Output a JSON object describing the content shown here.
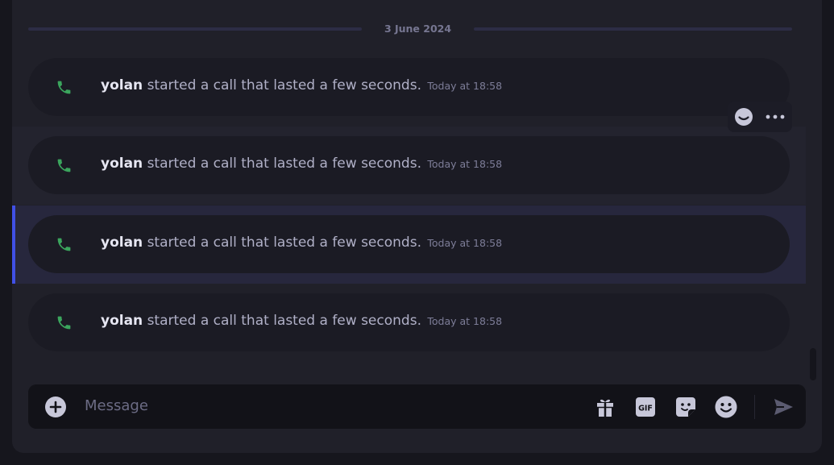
{
  "date_divider": "3 June 2024",
  "messages": [
    {
      "author": "yolan",
      "text": "started a call that lasted a few seconds.",
      "time": "Today at 18:58"
    },
    {
      "author": "yolan",
      "text": "started a call that lasted a few seconds.",
      "time": "Today at 18:58"
    },
    {
      "author": "yolan",
      "text": "started a call that lasted a few seconds.",
      "time": "Today at 18:58"
    },
    {
      "author": "yolan",
      "text": "started a call that lasted a few seconds.",
      "time": "Today at 18:58"
    }
  ],
  "composer": {
    "placeholder": "Message"
  },
  "icons": {
    "call": "phone-icon",
    "hover_actions": [
      "emoji-reaction-icon",
      "more-options-icon"
    ],
    "composer_tools": [
      "plus-circle-icon",
      "gift-icon",
      "gif-icon",
      "sticker-icon",
      "emoji-icon",
      "send-icon"
    ]
  },
  "colors": {
    "call_icon": "#3ba55d",
    "selected_accent": "#4150e6",
    "panel_bg": "#202029",
    "bubble_bg": "#1b1b24"
  }
}
